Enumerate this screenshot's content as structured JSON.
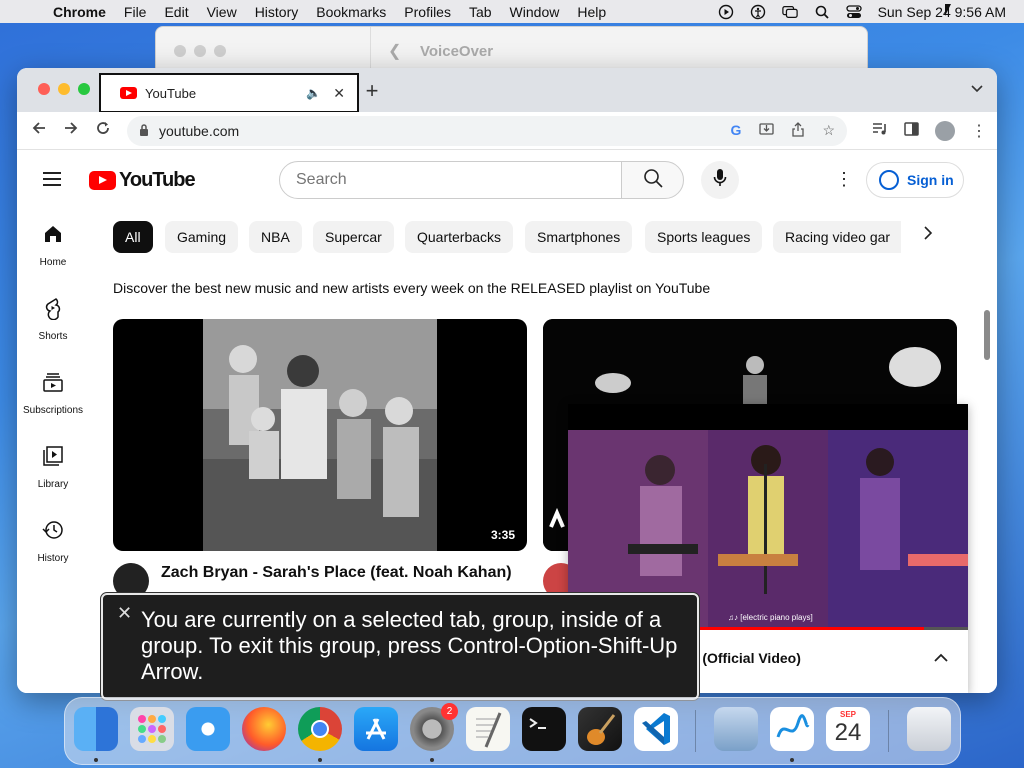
{
  "menubar": {
    "app_name": "Chrome",
    "items": [
      "File",
      "Edit",
      "View",
      "History",
      "Bookmarks",
      "Profiles",
      "Tab",
      "Window",
      "Help"
    ],
    "datetime": "Sun Sep 24  9:56 AM"
  },
  "voiceover_window": {
    "title": "VoiceOver"
  },
  "browser": {
    "tab": {
      "title": "YouTube"
    },
    "url": "youtube.com"
  },
  "youtube": {
    "logo_text": "YouTube",
    "search_placeholder": "Search",
    "signin_label": "Sign in",
    "sidebar": [
      {
        "label": "Home",
        "icon": "home-icon"
      },
      {
        "label": "Shorts",
        "icon": "shorts-icon"
      },
      {
        "label": "Subscriptions",
        "icon": "subscriptions-icon"
      },
      {
        "label": "Library",
        "icon": "library-icon"
      },
      {
        "label": "History",
        "icon": "history-icon"
      }
    ],
    "chips": [
      "All",
      "Gaming",
      "NBA",
      "Supercar",
      "Quarterbacks",
      "Smartphones",
      "Sports leagues",
      "Racing video gar"
    ],
    "description": "Discover the best new music and new artists every week on the RELEASED playlist on YouTube",
    "videos": [
      {
        "title": "Zach Bryan - Sarah's Place (feat. Noah Kahan)",
        "duration": "3:35"
      }
    ],
    "miniplayer": {
      "caption": "♫♪ [electric piano plays]",
      "title": "y! (Official Video)",
      "progress": 0.89
    }
  },
  "voiceover_caption": {
    "text": "You are currently on a selected tab, group, inside of a group.  To exit this group, press Control-Option-Shift-Up Arrow."
  },
  "dock": {
    "settings_badge": "2",
    "calendar_month": "SEP",
    "calendar_day": "24"
  }
}
